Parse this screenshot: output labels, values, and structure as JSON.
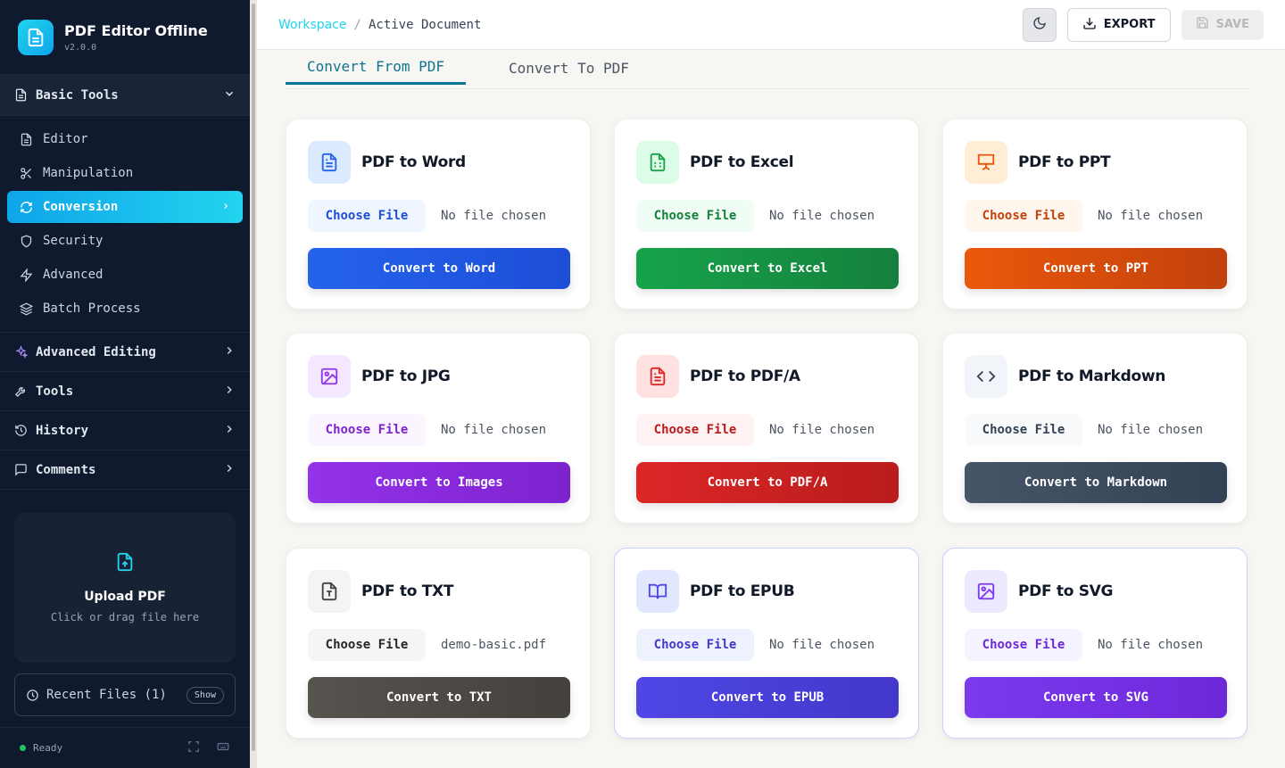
{
  "app": {
    "title": "PDF Editor Offline",
    "version": "v2.0.0"
  },
  "sidebar": {
    "basic_tools": "Basic Tools",
    "items": [
      {
        "label": "Editor",
        "icon": "file-text-icon"
      },
      {
        "label": "Manipulation",
        "icon": "scissors-icon"
      },
      {
        "label": "Conversion",
        "icon": "refresh-icon"
      },
      {
        "label": "Security",
        "icon": "shield-icon"
      },
      {
        "label": "Advanced",
        "icon": "lightning-icon"
      },
      {
        "label": "Batch Process",
        "icon": "layers-icon"
      }
    ],
    "sections": [
      {
        "label": "Advanced Editing",
        "icon": "sparkles-icon"
      },
      {
        "label": "Tools",
        "icon": "wrench-icon"
      },
      {
        "label": "History",
        "icon": "history-icon"
      },
      {
        "label": "Comments",
        "icon": "comment-icon"
      }
    ],
    "upload": {
      "title": "Upload PDF",
      "subtitle": "Click or drag file here"
    },
    "recent": {
      "label": "Recent Files (1)",
      "show": "Show"
    },
    "status": "Ready"
  },
  "header": {
    "crumb_workspace": "Workspace",
    "crumb_sep": "/",
    "crumb_doc": "Active Document",
    "export": "EXPORT",
    "save": "SAVE"
  },
  "tabs": {
    "active": "Convert From PDF",
    "inactive": "Convert To PDF"
  },
  "colors": {
    "accent": "#22d3ee",
    "sidebar_bg": "#101a2e"
  },
  "cards": [
    {
      "title": "PDF to Word",
      "choose": "Choose File",
      "file": "No file chosen",
      "button": "Convert to Word",
      "icon": "document-icon"
    },
    {
      "title": "PDF to Excel",
      "choose": "Choose File",
      "file": "No file chosen",
      "button": "Convert to Excel",
      "icon": "spreadsheet-icon"
    },
    {
      "title": "PDF to PPT",
      "choose": "Choose File",
      "file": "No file chosen",
      "button": "Convert to PPT",
      "icon": "presentation-icon"
    },
    {
      "title": "PDF to JPG",
      "choose": "Choose File",
      "file": "No file chosen",
      "button": "Convert to Images",
      "icon": "image-icon"
    },
    {
      "title": "PDF to PDF/A",
      "choose": "Choose File",
      "file": "No file chosen",
      "button": "Convert to PDF/A",
      "icon": "file-lines-icon"
    },
    {
      "title": "PDF to Markdown",
      "choose": "Choose File",
      "file": "No file chosen",
      "button": "Convert to Markdown",
      "icon": "code-icon"
    },
    {
      "title": "PDF to TXT",
      "choose": "Choose File",
      "file": "demo-basic.pdf",
      "button": "Convert to TXT",
      "icon": "text-file-icon"
    },
    {
      "title": "PDF to EPUB",
      "choose": "Choose File",
      "file": "No file chosen",
      "button": "Convert to EPUB",
      "icon": "book-icon"
    },
    {
      "title": "PDF to SVG",
      "choose": "Choose File",
      "file": "No file chosen",
      "button": "Convert to SVG",
      "icon": "image-icon"
    }
  ]
}
